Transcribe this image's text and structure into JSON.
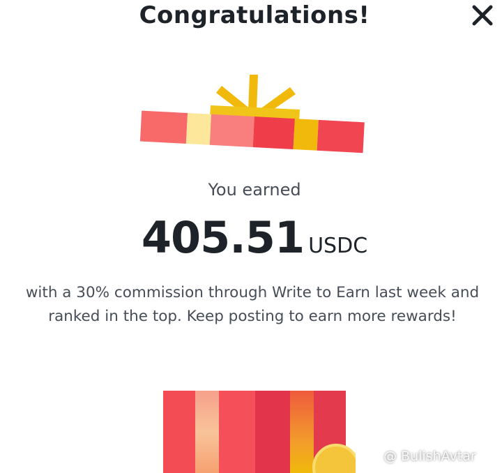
{
  "modal": {
    "title": "Congratulations!",
    "close_icon": "close-icon",
    "earned_label": "You earned",
    "amount": "405.51",
    "currency": "USDC",
    "description": "with a 30% commission through Write to Earn last week and ranked in the top. Keep posting to earn more rewards!"
  },
  "watermark": {
    "text": "@ BulishAvtar",
    "icon": "binance-logo-icon"
  },
  "colors": {
    "gold": "#f0b90b",
    "coral": "#f6465d",
    "pink": "#f88080",
    "text_primary": "#1e2329",
    "text_secondary": "#474d57"
  }
}
